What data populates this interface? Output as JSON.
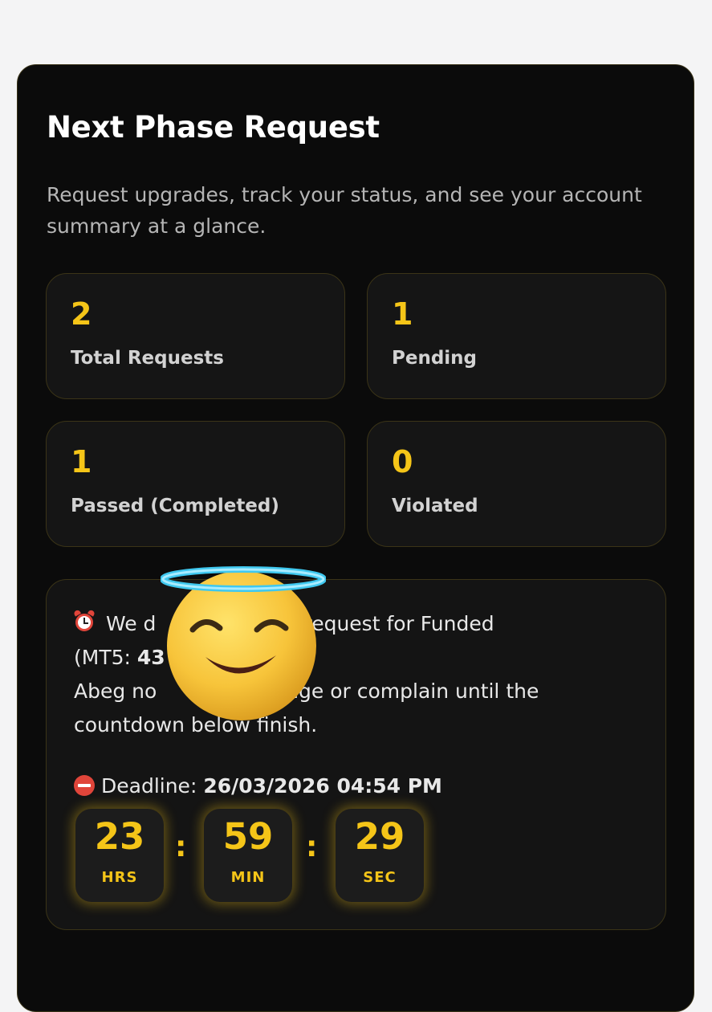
{
  "header": {
    "title": "Next Phase Request",
    "subtitle": "Request upgrades, track your status, and see your account summary at a glance."
  },
  "stats": [
    {
      "value": "2",
      "label": "Total Requests"
    },
    {
      "value": "1",
      "label": "Pending"
    },
    {
      "value": "1",
      "label": "Passed (Completed)"
    },
    {
      "value": "0",
      "label": "Violated"
    }
  ],
  "notice": {
    "line1_a": "We d",
    "line1_b": "ur request for Funded",
    "line2_a": "(MT5: ",
    "line2_b": "43",
    "line3_a": "Abeg no ",
    "line3_b": "essage or complain until the",
    "line4": "countdown below finish.",
    "deadline_label": "Deadline: ",
    "deadline_value": "26/03/2026 04:54 PM"
  },
  "countdown": {
    "hours": "23",
    "hours_unit": "HRS",
    "minutes": "59",
    "minutes_unit": "MIN",
    "seconds": "29",
    "seconds_unit": "SEC",
    "separator": ":"
  },
  "icons": {
    "alarm": "alarm-clock-icon",
    "no_entry": "no-entry-icon",
    "overlay": "smiling-face-with-halo-icon"
  },
  "colors": {
    "accent": "#f5c518",
    "card_bg": "#0b0b0b",
    "tile_bg": "#151515",
    "alert_red": "#e0453a"
  }
}
